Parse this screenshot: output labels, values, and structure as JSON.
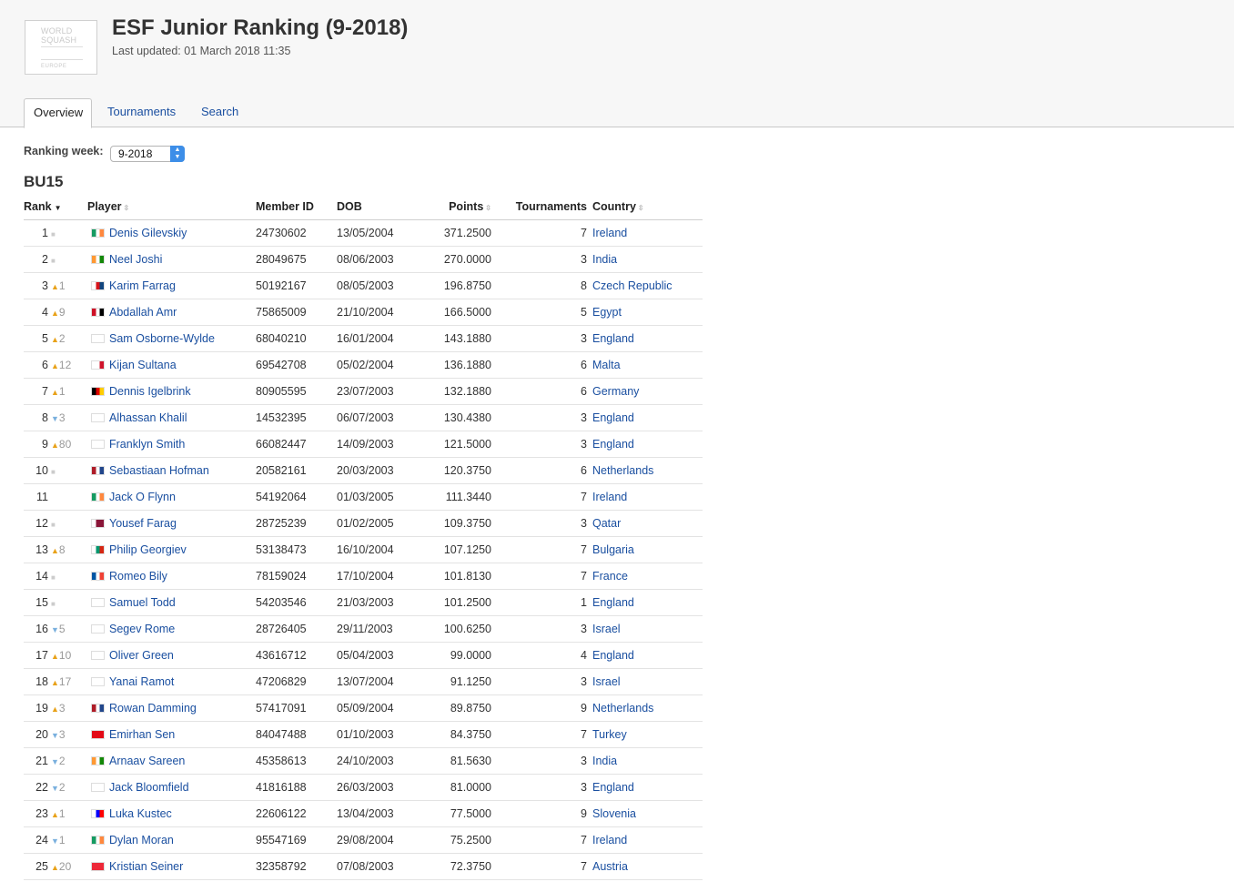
{
  "header": {
    "logo_line1": "WORLD",
    "logo_line2": "SQUASH",
    "logo_line3": "EUROPE",
    "title": "ESF Junior Ranking (9-2018)",
    "updated": "Last updated: 01 March 2018 11:35"
  },
  "tabs": [
    "Overview",
    "Tournaments",
    "Search"
  ],
  "filter": {
    "label": "Ranking week:",
    "value": "9-2018"
  },
  "category": "BU15",
  "columns": [
    "Rank",
    "Player",
    "Member ID",
    "DOB",
    "Points",
    "Tournaments",
    "Country"
  ],
  "colors": {
    "link": "#1a4fa0",
    "up": "#e8a21a",
    "down": "#7ab0de",
    "same": "#cccccc"
  },
  "rows": [
    {
      "rank": "1",
      "move": "same",
      "delta": "",
      "player": "Denis Gilevskiy",
      "member_id": "24730602",
      "dob": "13/05/2004",
      "points": "371.2500",
      "tournaments": "7",
      "country": "Ireland",
      "flag": [
        "#169b62",
        "#ffffff",
        "#ff883e"
      ]
    },
    {
      "rank": "2",
      "move": "same",
      "delta": "",
      "player": "Neel Joshi",
      "member_id": "28049675",
      "dob": "08/06/2003",
      "points": "270.0000",
      "tournaments": "3",
      "country": "India",
      "flag": [
        "#ff9933",
        "#ffffff",
        "#138808"
      ]
    },
    {
      "rank": "3",
      "move": "up",
      "delta": "1",
      "player": "Karim Farrag",
      "member_id": "50192167",
      "dob": "08/05/2003",
      "points": "196.8750",
      "tournaments": "8",
      "country": "Czech Republic",
      "flag": [
        "#ffffff",
        "#d7141a",
        "#11457e"
      ]
    },
    {
      "rank": "4",
      "move": "up",
      "delta": "9",
      "player": "Abdallah Amr",
      "member_id": "75865009",
      "dob": "21/10/2004",
      "points": "166.5000",
      "tournaments": "5",
      "country": "Egypt",
      "flag": [
        "#ce1126",
        "#ffffff",
        "#000000"
      ]
    },
    {
      "rank": "5",
      "move": "up",
      "delta": "2",
      "player": "Sam Osborne-Wylde",
      "member_id": "68040210",
      "dob": "16/01/2004",
      "points": "143.1880",
      "tournaments": "3",
      "country": "England",
      "flag": [
        "#ffffff",
        "#cf142b",
        "#ffffff"
      ]
    },
    {
      "rank": "6",
      "move": "up",
      "delta": "12",
      "player": "Kijan Sultana",
      "member_id": "69542708",
      "dob": "05/02/2004",
      "points": "136.1880",
      "tournaments": "6",
      "country": "Malta",
      "flag": [
        "#ffffff",
        "#ffffff",
        "#cf142b"
      ]
    },
    {
      "rank": "7",
      "move": "up",
      "delta": "1",
      "player": "Dennis Igelbrink",
      "member_id": "80905595",
      "dob": "23/07/2003",
      "points": "132.1880",
      "tournaments": "6",
      "country": "Germany",
      "flag": [
        "#000000",
        "#dd0000",
        "#ffce00"
      ]
    },
    {
      "rank": "8",
      "move": "down",
      "delta": "3",
      "player": "Alhassan Khalil",
      "member_id": "14532395",
      "dob": "06/07/2003",
      "points": "130.4380",
      "tournaments": "3",
      "country": "England",
      "flag": [
        "#ffffff",
        "#cf142b",
        "#ffffff"
      ]
    },
    {
      "rank": "9",
      "move": "up",
      "delta": "80",
      "player": "Franklyn Smith",
      "member_id": "66082447",
      "dob": "14/09/2003",
      "points": "121.5000",
      "tournaments": "3",
      "country": "England",
      "flag": [
        "#ffffff",
        "#cf142b",
        "#ffffff"
      ]
    },
    {
      "rank": "10",
      "move": "same",
      "delta": "",
      "player": "Sebastiaan Hofman",
      "member_id": "20582161",
      "dob": "20/03/2003",
      "points": "120.3750",
      "tournaments": "6",
      "country": "Netherlands",
      "flag": [
        "#ae1c28",
        "#ffffff",
        "#21468b"
      ]
    },
    {
      "rank": "11",
      "move": "none",
      "delta": "",
      "player": "Jack O Flynn",
      "member_id": "54192064",
      "dob": "01/03/2005",
      "points": "111.3440",
      "tournaments": "7",
      "country": "Ireland",
      "flag": [
        "#169b62",
        "#ffffff",
        "#ff883e"
      ]
    },
    {
      "rank": "12",
      "move": "same",
      "delta": "",
      "player": "Yousef Farag",
      "member_id": "28725239",
      "dob": "01/02/2005",
      "points": "109.3750",
      "tournaments": "3",
      "country": "Qatar",
      "flag": [
        "#ffffff",
        "#8a1538",
        "#8a1538"
      ]
    },
    {
      "rank": "13",
      "move": "up",
      "delta": "8",
      "player": "Philip Georgiev",
      "member_id": "53138473",
      "dob": "16/10/2004",
      "points": "107.1250",
      "tournaments": "7",
      "country": "Bulgaria",
      "flag": [
        "#ffffff",
        "#00966e",
        "#d62612"
      ]
    },
    {
      "rank": "14",
      "move": "same",
      "delta": "",
      "player": "Romeo Bily",
      "member_id": "78159024",
      "dob": "17/10/2004",
      "points": "101.8130",
      "tournaments": "7",
      "country": "France",
      "flag": [
        "#0055a4",
        "#ffffff",
        "#ef4135"
      ]
    },
    {
      "rank": "15",
      "move": "same",
      "delta": "",
      "player": "Samuel Todd",
      "member_id": "54203546",
      "dob": "21/03/2003",
      "points": "101.2500",
      "tournaments": "1",
      "country": "England",
      "flag": [
        "#ffffff",
        "#cf142b",
        "#ffffff"
      ]
    },
    {
      "rank": "16",
      "move": "down",
      "delta": "5",
      "player": "Segev Rome",
      "member_id": "28726405",
      "dob": "29/11/2003",
      "points": "100.6250",
      "tournaments": "3",
      "country": "Israel",
      "flag": [
        "#ffffff",
        "#0038b8",
        "#ffffff"
      ]
    },
    {
      "rank": "17",
      "move": "up",
      "delta": "10",
      "player": "Oliver Green",
      "member_id": "43616712",
      "dob": "05/04/2003",
      "points": "99.0000",
      "tournaments": "4",
      "country": "England",
      "flag": [
        "#ffffff",
        "#cf142b",
        "#ffffff"
      ]
    },
    {
      "rank": "18",
      "move": "up",
      "delta": "17",
      "player": "Yanai Ramot",
      "member_id": "47206829",
      "dob": "13/07/2004",
      "points": "91.1250",
      "tournaments": "3",
      "country": "Israel",
      "flag": [
        "#ffffff",
        "#0038b8",
        "#ffffff"
      ]
    },
    {
      "rank": "19",
      "move": "up",
      "delta": "3",
      "player": "Rowan Damming",
      "member_id": "57417091",
      "dob": "05/09/2004",
      "points": "89.8750",
      "tournaments": "9",
      "country": "Netherlands",
      "flag": [
        "#ae1c28",
        "#ffffff",
        "#21468b"
      ]
    },
    {
      "rank": "20",
      "move": "down",
      "delta": "3",
      "player": "Emirhan Sen",
      "member_id": "84047488",
      "dob": "01/10/2003",
      "points": "84.3750",
      "tournaments": "7",
      "country": "Turkey",
      "flag": [
        "#e30a17",
        "#e30a17",
        "#e30a17"
      ]
    },
    {
      "rank": "21",
      "move": "down",
      "delta": "2",
      "player": "Arnaav Sareen",
      "member_id": "45358613",
      "dob": "24/10/2003",
      "points": "81.5630",
      "tournaments": "3",
      "country": "India",
      "flag": [
        "#ff9933",
        "#ffffff",
        "#138808"
      ]
    },
    {
      "rank": "22",
      "move": "down",
      "delta": "2",
      "player": "Jack Bloomfield",
      "member_id": "41816188",
      "dob": "26/03/2003",
      "points": "81.0000",
      "tournaments": "3",
      "country": "England",
      "flag": [
        "#ffffff",
        "#cf142b",
        "#ffffff"
      ]
    },
    {
      "rank": "23",
      "move": "up",
      "delta": "1",
      "player": "Luka Kustec",
      "member_id": "22606122",
      "dob": "13/04/2003",
      "points": "77.5000",
      "tournaments": "9",
      "country": "Slovenia",
      "flag": [
        "#ffffff",
        "#0000ff",
        "#ff0000"
      ]
    },
    {
      "rank": "24",
      "move": "down",
      "delta": "1",
      "player": "Dylan Moran",
      "member_id": "95547169",
      "dob": "29/08/2004",
      "points": "75.2500",
      "tournaments": "7",
      "country": "Ireland",
      "flag": [
        "#169b62",
        "#ffffff",
        "#ff883e"
      ]
    },
    {
      "rank": "25",
      "move": "up",
      "delta": "20",
      "player": "Kristian Seiner",
      "member_id": "32358792",
      "dob": "07/08/2003",
      "points": "72.3750",
      "tournaments": "7",
      "country": "Austria",
      "flag": [
        "#ed2939",
        "#ffffff",
        "#ed2939"
      ]
    }
  ]
}
